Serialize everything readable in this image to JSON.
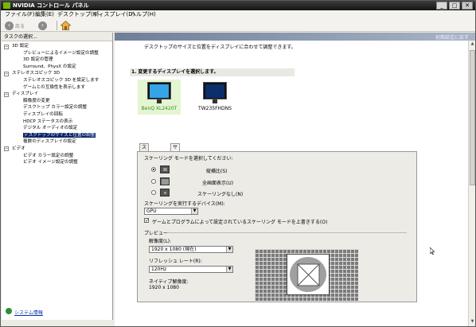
{
  "window": {
    "title": "NVIDIA コントロール パネル",
    "controls": {
      "minimize": "_",
      "maximize": "□",
      "close": "✕"
    }
  },
  "menu": [
    "ファイル(F)",
    "編集(E)",
    "デスクトップ(K)",
    "ディスプレイ(D)",
    "ヘルプ(H)"
  ],
  "toolbar": {
    "back_label": "戻る",
    "back_icon": "back-arrow-icon",
    "forward_icon": "forward-arrow-icon",
    "home_icon": "home-icon"
  },
  "left": {
    "header": "タスクの選択...",
    "tree": [
      {
        "type": "cat",
        "label": "3D 設定"
      },
      {
        "type": "item",
        "label": "プレビューによるイメージ設定の調整"
      },
      {
        "type": "item",
        "label": "3D 設定の管理"
      },
      {
        "type": "item",
        "label": "Surround、PhysX の設定"
      },
      {
        "type": "cat",
        "label": "ステレオスコピック 3D"
      },
      {
        "type": "item",
        "label": "ステレオスコピック 3D を設定します"
      },
      {
        "type": "item",
        "label": "ゲームとの互換性を表示します"
      },
      {
        "type": "cat",
        "label": "ディスプレイ"
      },
      {
        "type": "item",
        "label": "解像度の変更"
      },
      {
        "type": "item",
        "label": "デスクトップ カラー設定の調整"
      },
      {
        "type": "item",
        "label": "ディスプレイの回転"
      },
      {
        "type": "item",
        "label": "HDCP ステータスの表示"
      },
      {
        "type": "item",
        "label": "デジタル オーディオの設定"
      },
      {
        "type": "item",
        "label": "デスクトップのサイズと位置の調整",
        "selected": true
      },
      {
        "type": "item",
        "label": "複数のディスプレイの設定"
      },
      {
        "type": "cat",
        "label": "ビデオ"
      },
      {
        "type": "item",
        "label": "ビデオ カラー設定の調整"
      },
      {
        "type": "item",
        "label": "ビデオ イメージ設定の調整"
      }
    ],
    "system_info": "システム情報"
  },
  "right": {
    "restore_defaults": "初期設定に戻す",
    "description": "デスクトップのサイズと位置をディスプレイに合わせて調整できます。",
    "step1": "1. 変更するディスプレイを選択します。",
    "displays": [
      {
        "name": "BenQ XL2420T",
        "selected": true
      },
      {
        "name": "TW235FHDNS",
        "selected": false
      }
    ],
    "tabs": [
      "スケーリング",
      "サイズ"
    ],
    "scaling": {
      "prompt": "スケーリング モードを選択してください:",
      "modes": [
        {
          "label": "縦横比(S)",
          "checked": true
        },
        {
          "label": "全画面表示(U)",
          "checked": false
        },
        {
          "label": "スケーリングなし(N)",
          "checked": false
        }
      ],
      "device_label": "スケーリングを実行するデバイス(M):",
      "device_value": "GPU",
      "override_label": "ゲームとプログラムによって設定されているスケーリング モードを上書きする(O)",
      "override_checked": "✓"
    },
    "preview": {
      "heading": "プレビュー",
      "resolution_label": "解像度(L):",
      "resolution_value": "1920 x 1080 (現在)",
      "refresh_label": "リフレッシュ レート(R):",
      "refresh_value": "120Hz",
      "native_label": "ネイティブ解像度:",
      "native_value": "1920 x 1080"
    }
  }
}
